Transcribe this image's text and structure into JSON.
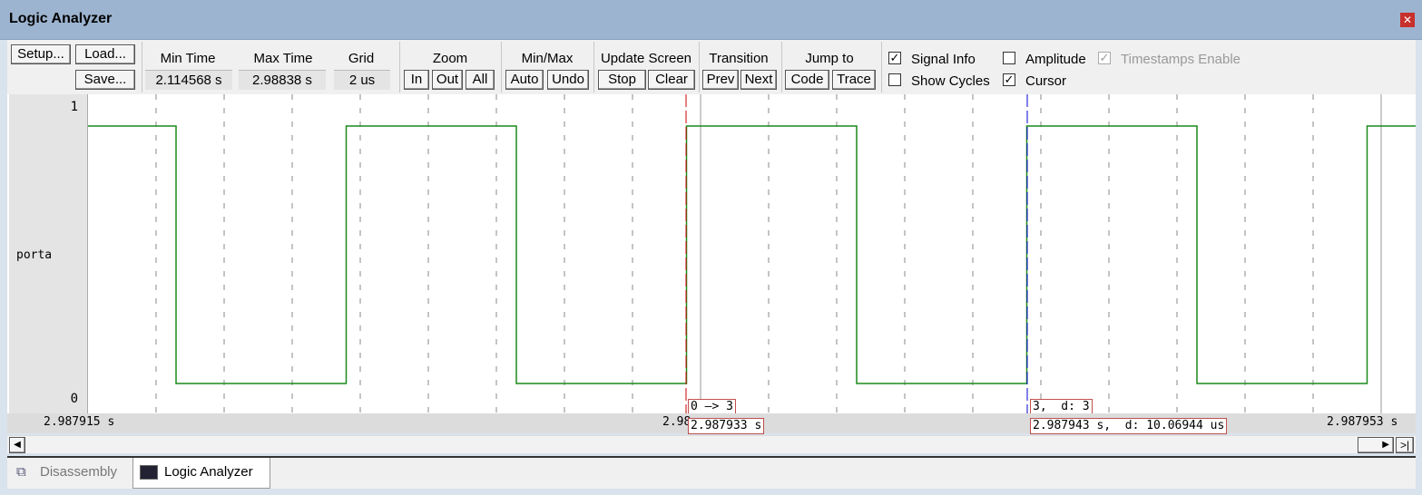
{
  "window": {
    "title": "Logic Analyzer",
    "close_icon": "close-icon"
  },
  "toolbar": {
    "setup": "Setup...",
    "load": "Load...",
    "save": "Save...",
    "min_time_label": "Min Time",
    "min_time": "2.114568 s",
    "max_time_label": "Max Time",
    "max_time": "2.98838 s",
    "grid_label": "Grid",
    "grid": "2 us",
    "zoom_label": "Zoom",
    "zoom_in": "In",
    "zoom_out": "Out",
    "zoom_all": "All",
    "minmax_label": "Min/Max",
    "auto": "Auto",
    "undo": "Undo",
    "update_label": "Update Screen",
    "stop": "Stop",
    "clear": "Clear",
    "transition_label": "Transition",
    "prev": "Prev",
    "next": "Next",
    "jump_label": "Jump to",
    "code": "Code",
    "trace": "Trace",
    "signal_info": {
      "label": "Signal Info",
      "checked": true
    },
    "show_cycles": {
      "label": "Show Cycles",
      "checked": false
    },
    "amplitude": {
      "label": "Amplitude",
      "checked": false
    },
    "cursor": {
      "label": "Cursor",
      "checked": true
    },
    "timestamps": {
      "label": "Timestamps Enable",
      "checked": true,
      "disabled": true
    }
  },
  "signal": {
    "name": "porta",
    "max": "1",
    "min": "0",
    "color": "#1a8a1a",
    "levels": [
      1,
      0,
      1,
      0,
      1,
      0,
      1,
      0,
      1
    ]
  },
  "axis": {
    "left": "2.987915 s",
    "right": "2.987953 s",
    "mid_partial": "2.98"
  },
  "cursors": {
    "red": {
      "color": "#d00000",
      "value_box": "0 —> 3",
      "time_box": "2.987933 s"
    },
    "blue": {
      "color": "#0000d0",
      "value_box": "3,  d: 3",
      "time_box": "2.987943 s,  d: 10.06944 us"
    }
  },
  "tabs": [
    {
      "label": "Disassembly",
      "active": false
    },
    {
      "label": "Logic Analyzer",
      "active": true
    }
  ]
}
